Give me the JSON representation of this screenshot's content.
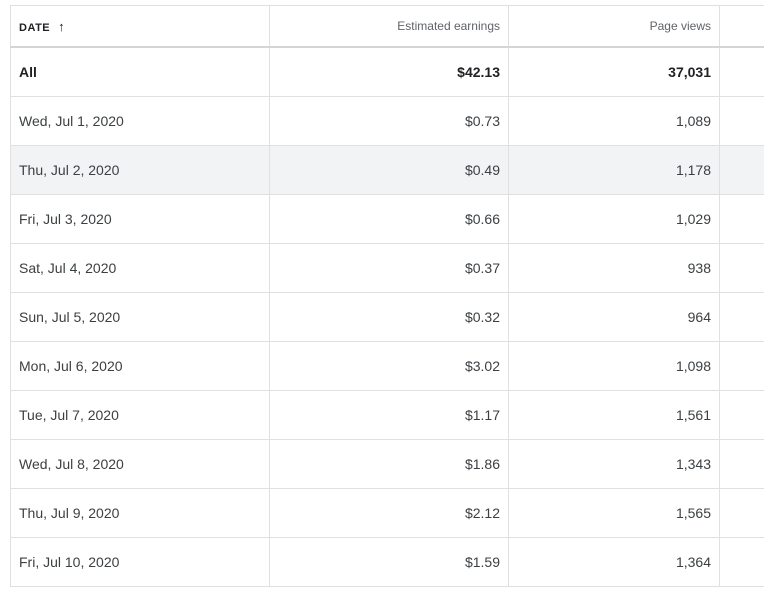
{
  "table": {
    "headers": {
      "date": "DATE",
      "sort_icon": "arrow-up-icon",
      "earnings": "Estimated earnings",
      "page_views": "Page views"
    },
    "total": {
      "label": "All",
      "earnings": "$42.13",
      "page_views": "37,031"
    },
    "rows": [
      {
        "date": "Wed, Jul 1, 2020",
        "earnings": "$0.73",
        "page_views": "1,089"
      },
      {
        "date": "Thu, Jul 2, 2020",
        "earnings": "$0.49",
        "page_views": "1,178"
      },
      {
        "date": "Fri, Jul 3, 2020",
        "earnings": "$0.66",
        "page_views": "1,029"
      },
      {
        "date": "Sat, Jul 4, 2020",
        "earnings": "$0.37",
        "page_views": "938"
      },
      {
        "date": "Sun, Jul 5, 2020",
        "earnings": "$0.32",
        "page_views": "964"
      },
      {
        "date": "Mon, Jul 6, 2020",
        "earnings": "$3.02",
        "page_views": "1,098"
      },
      {
        "date": "Tue, Jul 7, 2020",
        "earnings": "$1.17",
        "page_views": "1,561"
      },
      {
        "date": "Wed, Jul 8, 2020",
        "earnings": "$1.86",
        "page_views": "1,343"
      },
      {
        "date": "Thu, Jul 9, 2020",
        "earnings": "$2.12",
        "page_views": "1,565"
      },
      {
        "date": "Fri, Jul 10, 2020",
        "earnings": "$1.59",
        "page_views": "1,364"
      }
    ],
    "highlighted_row_index": 1,
    "colors": {
      "row_highlight": "#f1f3f4",
      "border": "#e0e0e0",
      "text": "#3c4043"
    }
  }
}
